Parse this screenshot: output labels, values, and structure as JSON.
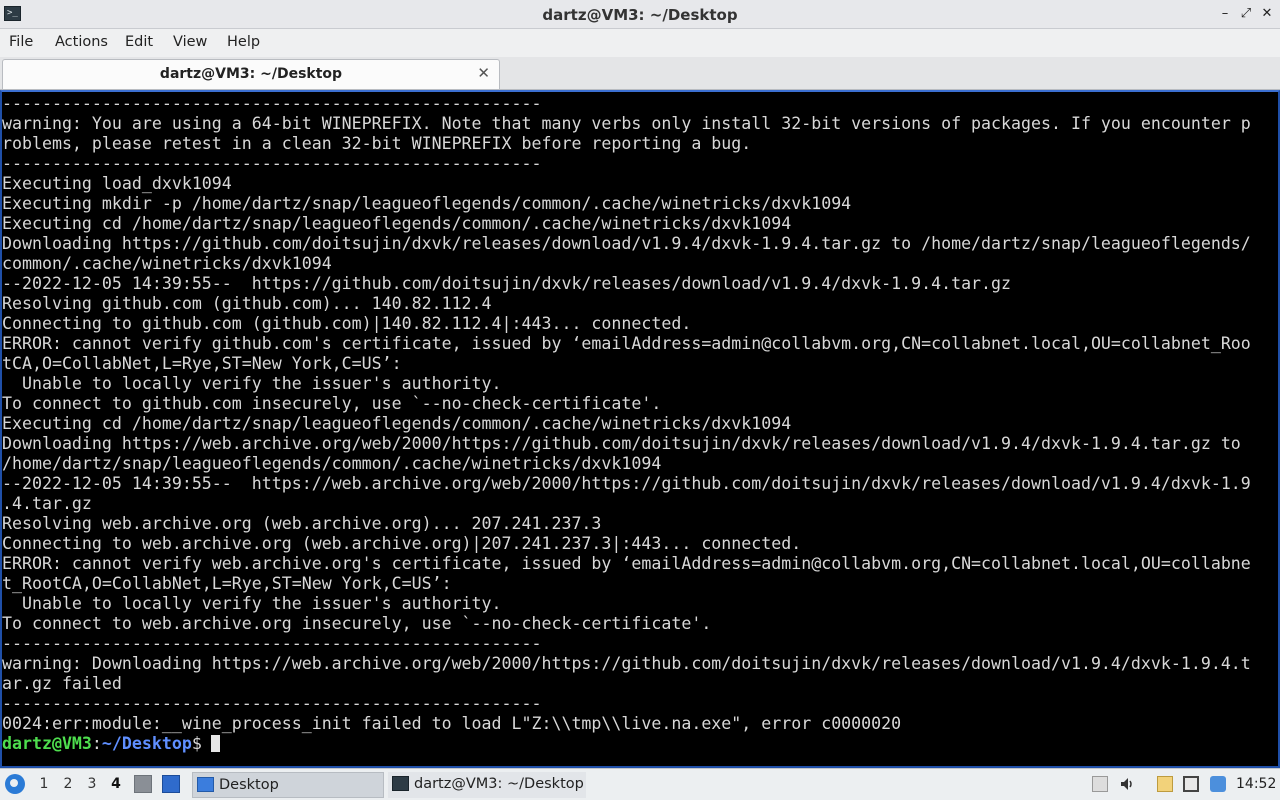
{
  "window": {
    "title": "dartz@VM3: ~/Desktop",
    "app_icon": "terminal-icon",
    "controls": {
      "minimize": "–",
      "maximize": "⤢",
      "close": "✕"
    }
  },
  "menubar": {
    "items": [
      "File",
      "Actions",
      "Edit",
      "View",
      "Help"
    ]
  },
  "tabs": [
    {
      "label": "dartz@VM3: ~/Desktop",
      "close": "✕"
    }
  ],
  "terminal": {
    "lines": [
      "------------------------------------------------------",
      "warning: You are using a 64-bit WINEPREFIX. Note that many verbs only install 32-bit versions of packages. If you encounter p",
      "roblems, please retest in a clean 32-bit WINEPREFIX before reporting a bug.",
      "------------------------------------------------------",
      "Executing load_dxvk1094",
      "Executing mkdir -p /home/dartz/snap/leagueoflegends/common/.cache/winetricks/dxvk1094",
      "Executing cd /home/dartz/snap/leagueoflegends/common/.cache/winetricks/dxvk1094",
      "Downloading https://github.com/doitsujin/dxvk/releases/download/v1.9.4/dxvk-1.9.4.tar.gz to /home/dartz/snap/leagueoflegends/",
      "common/.cache/winetricks/dxvk1094",
      "--2022-12-05 14:39:55--  https://github.com/doitsujin/dxvk/releases/download/v1.9.4/dxvk-1.9.4.tar.gz",
      "Resolving github.com (github.com)... 140.82.112.4",
      "Connecting to github.com (github.com)|140.82.112.4|:443... connected.",
      "ERROR: cannot verify github.com's certificate, issued by ‘emailAddress=admin@collabvm.org,CN=collabnet.local,OU=collabnet_Roo",
      "tCA,O=CollabNet,L=Rye,ST=New York,C=US’:",
      "  Unable to locally verify the issuer's authority.",
      "To connect to github.com insecurely, use `--no-check-certificate'.",
      "Executing cd /home/dartz/snap/leagueoflegends/common/.cache/winetricks/dxvk1094",
      "Downloading https://web.archive.org/web/2000/https://github.com/doitsujin/dxvk/releases/download/v1.9.4/dxvk-1.9.4.tar.gz to",
      "/home/dartz/snap/leagueoflegends/common/.cache/winetricks/dxvk1094",
      "--2022-12-05 14:39:55--  https://web.archive.org/web/2000/https://github.com/doitsujin/dxvk/releases/download/v1.9.4/dxvk-1.9",
      ".4.tar.gz",
      "Resolving web.archive.org (web.archive.org)... 207.241.237.3",
      "Connecting to web.archive.org (web.archive.org)|207.241.237.3|:443... connected.",
      "ERROR: cannot verify web.archive.org's certificate, issued by ‘emailAddress=admin@collabvm.org,CN=collabnet.local,OU=collabne",
      "t_RootCA,O=CollabNet,L=Rye,ST=New York,C=US’:",
      "  Unable to locally verify the issuer's authority.",
      "To connect to web.archive.org insecurely, use `--no-check-certificate'.",
      "------------------------------------------------------",
      "warning: Downloading https://web.archive.org/web/2000/https://github.com/doitsujin/dxvk/releases/download/v1.9.4/dxvk-1.9.4.t",
      "ar.gz failed",
      "------------------------------------------------------",
      "0024:err:module:__wine_process_init failed to load L\"Z:\\\\tmp\\\\live.na.exe\", error c0000020"
    ],
    "prompt": {
      "user_host": "dartz@VM3",
      "separator": ":",
      "path": "~/Desktop",
      "symbol": "$"
    },
    "colors": {
      "background": "#000000",
      "text": "#d8d8d8",
      "prompt_user": "#4ede4e",
      "prompt_path": "#5f8fff"
    }
  },
  "taskbar": {
    "start_icon": "lxqt-start-icon",
    "workspaces": [
      "1",
      "2",
      "3",
      "4"
    ],
    "active_workspace": "4",
    "quicklaunch": [
      "file-manager-icon",
      "show-desktop-icon"
    ],
    "tasks": [
      {
        "label": "Desktop",
        "icon": "desktop-folder-icon"
      },
      {
        "label": "dartz@VM3: ~/Desktop",
        "icon": "terminal-icon"
      }
    ],
    "tray": [
      "tray-expand-icon",
      "volume-icon",
      "clipboard-icon",
      "display-icon",
      "network-icon"
    ],
    "clock": "14:52"
  }
}
